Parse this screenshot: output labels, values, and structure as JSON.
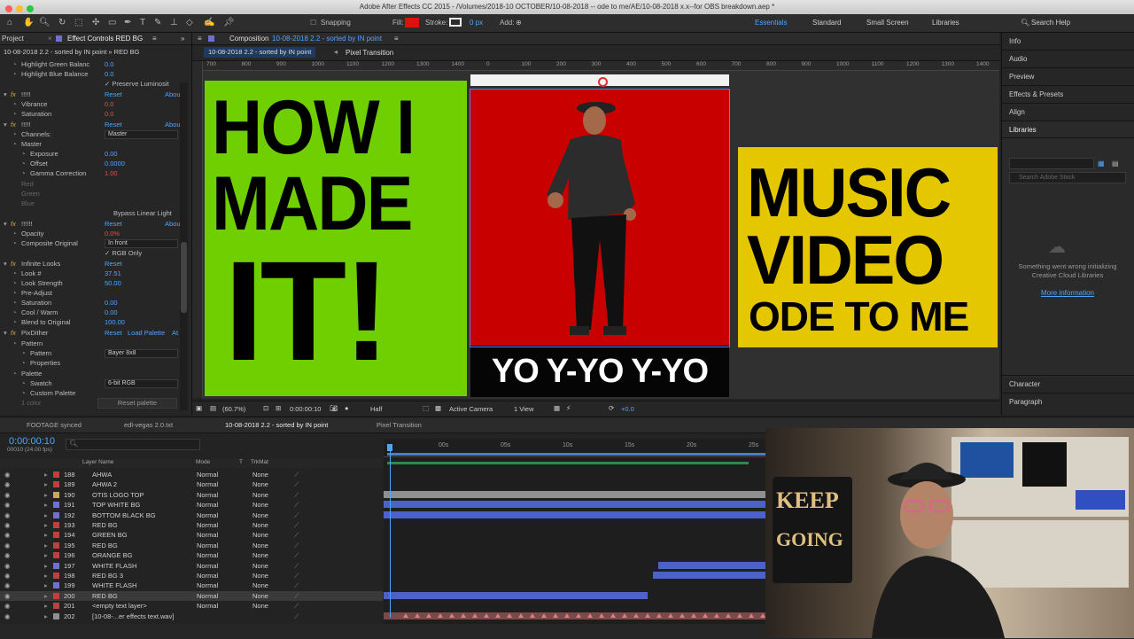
{
  "window": {
    "title": "Adobe After Effects CC 2015 - /Volumes/2018-10 OCTOBER/10-08-2018 -- ode to me/AE/10-08-2018 x.x--for OBS breakdown.aep *"
  },
  "toolbar": {
    "snapping": "Snapping",
    "fill": "Fill:",
    "stroke": "Stroke:",
    "stroke_px": "0 px",
    "add": "Add:",
    "workspaces": [
      "Essentials",
      "Standard",
      "Small Screen",
      "Libraries"
    ],
    "search": "Search Help"
  },
  "left_panel": {
    "project_tab": "Project",
    "effects_tab": "Effect Controls RED BG",
    "breadcrumb": "10-08-2018 2.2 - sorted by IN point » RED BG",
    "reset": "Reset",
    "about": "Abou",
    "rows": {
      "hgb": "Highlight Green Balanc",
      "hgb_val": "0.0",
      "hbb": "Highlight Blue Balance",
      "hbb_val": "0.0",
      "preserve": "Preserve Luminosit",
      "fx1": "!!!!!",
      "vibrance": "Vibrance",
      "vibrance_val": "0.0",
      "saturation": "Saturation",
      "saturation_val": "0.0",
      "fx2": "!!!!!",
      "channels": "Channels:",
      "channels_val": "Master",
      "master": "Master",
      "exposure": "Exposure",
      "exposure_val": "0.00",
      "offset": "Offset",
      "offset_val": "0.0000",
      "gamma": "Gamma Correction",
      "gamma_val": "1.00",
      "red": "Red",
      "green": "Green",
      "blue": "Blue",
      "bypass": "Bypass Linear Light",
      "fx3": "!!!!!!",
      "opacity": "Opacity",
      "opacity_val": "0.0%",
      "composite": "Composite Original",
      "composite_val": "In front",
      "rgbonly": "RGB Only",
      "infinite": "Infinite Looks",
      "look": "Look #",
      "look_val": "37.51",
      "strength": "Look Strength",
      "strength_val": "50.00",
      "preadjust": "Pre-Adjust",
      "sat2": "Saturation",
      "sat2_val": "0.00",
      "coolwarm": "Cool / Warm",
      "coolwarm_val": "0.00",
      "blend": "Blend to Original",
      "blend_val": "100.00",
      "pixdither": "PixDither",
      "loadpalette": "Load Palette",
      "at": "At",
      "pattern_grp": "Pattern",
      "pattern": "Pattern",
      "pattern_val": "Bayer 8x8",
      "properties": "Properties",
      "palette": "Palette",
      "swatch": "Swatch",
      "swatch_val": "6-bit RGB",
      "custompalette": "Custom Palette",
      "xcolor": "1 color",
      "resetpalette": "Reset palette"
    }
  },
  "composition": {
    "tab": "Composition",
    "tab_comp": "10-08-2018 2.2 - sorted by IN point",
    "crumb1": "10-08-2018 2.2 - sorted by IN point",
    "crumb2": "Pixel Transition",
    "ruler": [
      "700",
      "800",
      "900",
      "1000",
      "1100",
      "1200",
      "1300",
      "1400",
      "0",
      "100",
      "200",
      "300",
      "400",
      "500",
      "600",
      "700",
      "800",
      "900",
      "1000",
      "1100",
      "1200",
      "1300",
      "1400"
    ],
    "left_card": {
      "l1": "HOW I",
      "l2": "MADE",
      "l3": "IT!"
    },
    "center_caption": "YO Y-YO Y-YO",
    "right_card": {
      "l1": "MUSIC",
      "l2": "VIDEO",
      "l3": "ODE TO ME"
    },
    "footer": {
      "zoom": "(60.7%)",
      "time": "0:00:00:10",
      "res": "Half",
      "camera": "Active Camera",
      "view": "1 View",
      "exposure": "+0.0"
    }
  },
  "right_panel": {
    "items": [
      "Info",
      "Audio",
      "Preview",
      "Effects & Presets",
      "Align",
      "Libraries"
    ],
    "search_ph": "Search Adobe Stock",
    "error": "Something went wrong initializing Creative Cloud Libraries",
    "more": "More information",
    "bottom": [
      "Character",
      "Paragraph"
    ]
  },
  "timeline": {
    "tabs": [
      "FOOTAGE synced",
      "edl-vegas 2.0.txt",
      "10-08-2018 2.2 - sorted by IN point",
      "Pixel Transition"
    ],
    "timecode": "0:00:00:10",
    "fps": "00010 (24.00 fps)",
    "cols": {
      "layer_name": "Layer Name",
      "mode": "Mode",
      "t": "T",
      "trkmat": "TrkMat"
    },
    "ruler": [
      "00s",
      "05s",
      "10s",
      "15s",
      "20s",
      "25s",
      "30s"
    ],
    "layers": [
      {
        "num": "188",
        "name": "AHWA",
        "mode": "Normal",
        "trk": "None",
        "color": "#c04040"
      },
      {
        "num": "189",
        "name": "AHWA 2",
        "mode": "Normal",
        "trk": "None",
        "color": "#c04040"
      },
      {
        "num": "190",
        "name": "OTIS LOGO TOP",
        "mode": "Normal",
        "trk": "None",
        "color": "#c8a850"
      },
      {
        "num": "191",
        "name": "TOP WHITE BG",
        "mode": "Normal",
        "trk": "None",
        "color": "#7070d0"
      },
      {
        "num": "192",
        "name": "BOTTOM BLACK BG",
        "mode": "Normal",
        "trk": "None",
        "color": "#7070d0"
      },
      {
        "num": "193",
        "name": "RED BG",
        "mode": "Normal",
        "trk": "None",
        "color": "#c04040"
      },
      {
        "num": "194",
        "name": "GREEN BG",
        "mode": "Normal",
        "trk": "None",
        "color": "#c04040"
      },
      {
        "num": "195",
        "name": "RED BG",
        "mode": "Normal",
        "trk": "None",
        "color": "#c04040"
      },
      {
        "num": "196",
        "name": "ORANGE BG",
        "mode": "Normal",
        "trk": "None",
        "color": "#c04040"
      },
      {
        "num": "197",
        "name": "WHITE FLASH",
        "mode": "Normal",
        "trk": "None",
        "color": "#7070d0"
      },
      {
        "num": "198",
        "name": "RED BG 3",
        "mode": "Normal",
        "trk": "None",
        "color": "#c04040"
      },
      {
        "num": "199",
        "name": "WHITE FLASH",
        "mode": "Normal",
        "trk": "None",
        "color": "#7070d0"
      },
      {
        "num": "200",
        "name": "RED BG",
        "mode": "Normal",
        "trk": "None",
        "color": "#c04040"
      },
      {
        "num": "201",
        "name": "<empty text layer>",
        "mode": "Normal",
        "trk": "None",
        "color": "#c04040"
      },
      {
        "num": "202",
        "name": "[10-08-...er effects text.wav]",
        "mode": "",
        "trk": "",
        "color": "#909090"
      }
    ]
  },
  "webcam": {
    "sign1": "KEEP",
    "sign2": "GOING"
  },
  "colors": {
    "accent": "#4ea5ff",
    "selected_bar": "#4b63c8",
    "green_card": "#6fcf00",
    "red_card": "#c80000",
    "yellow_card": "#e5c700"
  }
}
